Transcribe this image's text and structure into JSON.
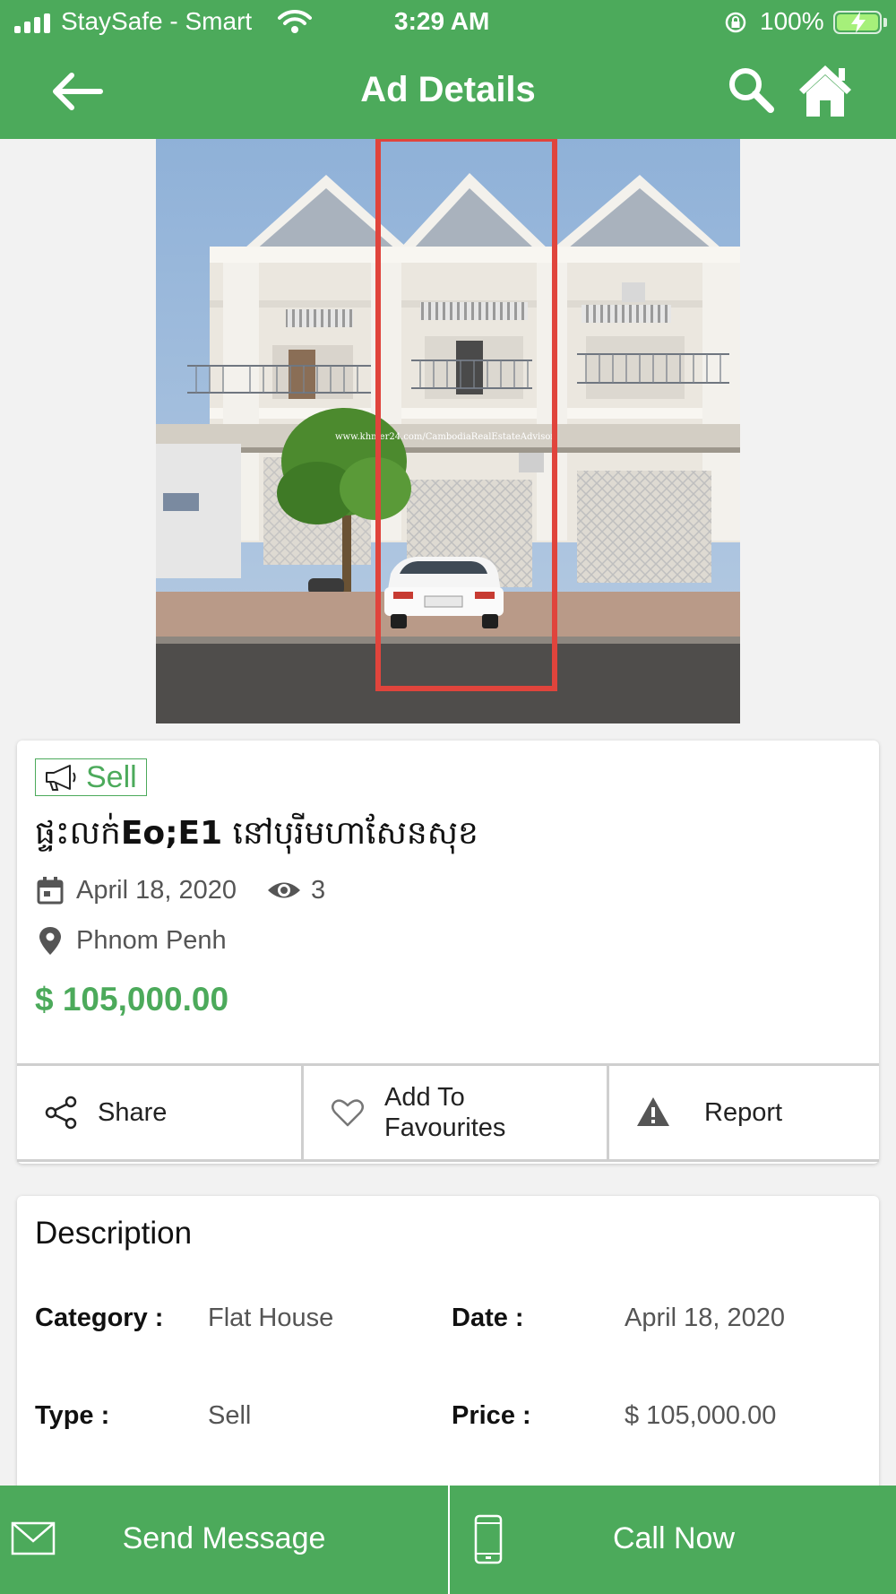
{
  "status_bar": {
    "carrier": "StaySafe - Smart",
    "time": "3:29 AM",
    "battery": "100%"
  },
  "app_bar": {
    "title": "Ad Details",
    "icons": [
      "back-arrow-icon",
      "search-icon",
      "home-icon"
    ]
  },
  "photo": {
    "watermark": "www.khmer24.com/CambodiaRealEstateAdvisor"
  },
  "ad": {
    "tag": "Sell",
    "title_prefix": "ផ្ទះលក់",
    "title_bold": "Eo;E1",
    "title_suffix": " នៅបុរីមហាសែនសុខ",
    "date": "April 18, 2020",
    "views": "3",
    "location": "Phnom Penh",
    "price": "$ 105,000.00"
  },
  "actions": {
    "share": "Share",
    "favourites_line1": "Add To",
    "favourites_line2": "Favourites",
    "report": "Report"
  },
  "description": {
    "title": "Description",
    "category_label": "Category :",
    "category_value": "Flat House",
    "date_label": "Date :",
    "date_value": "April 18, 2020",
    "type_label": "Type :",
    "type_value": "Sell",
    "price_label": "Price :",
    "price_value": "$ 105,000.00"
  },
  "bottom_bar": {
    "send_message": "Send Message",
    "call_now": "Call Now"
  },
  "colors": {
    "brand_green": "#4caa5b",
    "highlight_red": "#e0443c"
  }
}
